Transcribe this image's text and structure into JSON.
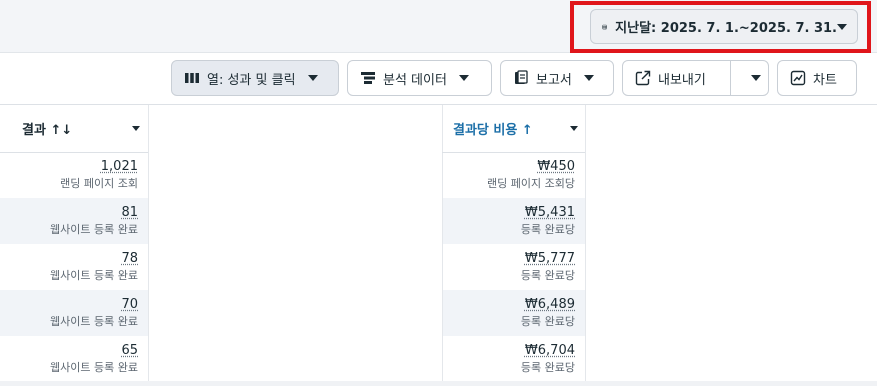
{
  "date_picker": {
    "label": "지난달: 2025. 7. 1.~2025. 7. 31.",
    "icon": "calendar-icon"
  },
  "toolbar": {
    "columns_label": "열: 성과 및 클릭",
    "breakdown_label": "분석 데이터",
    "reports_label": "보고서",
    "export_label": "내보내기",
    "chart_label": "차트"
  },
  "table": {
    "headers": {
      "results": "결과 ↑↓",
      "cost_per_result": "결과당 비용 ↑"
    },
    "rows": [
      {
        "result": "1,021",
        "result_type": "랜딩 페이지 조회",
        "cost": "₩450",
        "cost_type": "랜딩 페이지 조회당"
      },
      {
        "result": "81",
        "result_type": "웹사이트 등록 완료",
        "cost": "₩5,431",
        "cost_type": "등록 완료당"
      },
      {
        "result": "78",
        "result_type": "웹사이트 등록 완료",
        "cost": "₩5,777",
        "cost_type": "등록 완료당"
      },
      {
        "result": "70",
        "result_type": "웹사이트 등록 완료",
        "cost": "₩6,489",
        "cost_type": "등록 완료당"
      },
      {
        "result": "65",
        "result_type": "웹사이트 등록 완료",
        "cost": "₩6,704",
        "cost_type": "등록 완료당"
      }
    ]
  },
  "colors": {
    "highlight_border": "#e0161b",
    "sorted_header": "#1c6fa8",
    "stripe": "#f1f4f8",
    "text": "#1c2b33"
  }
}
